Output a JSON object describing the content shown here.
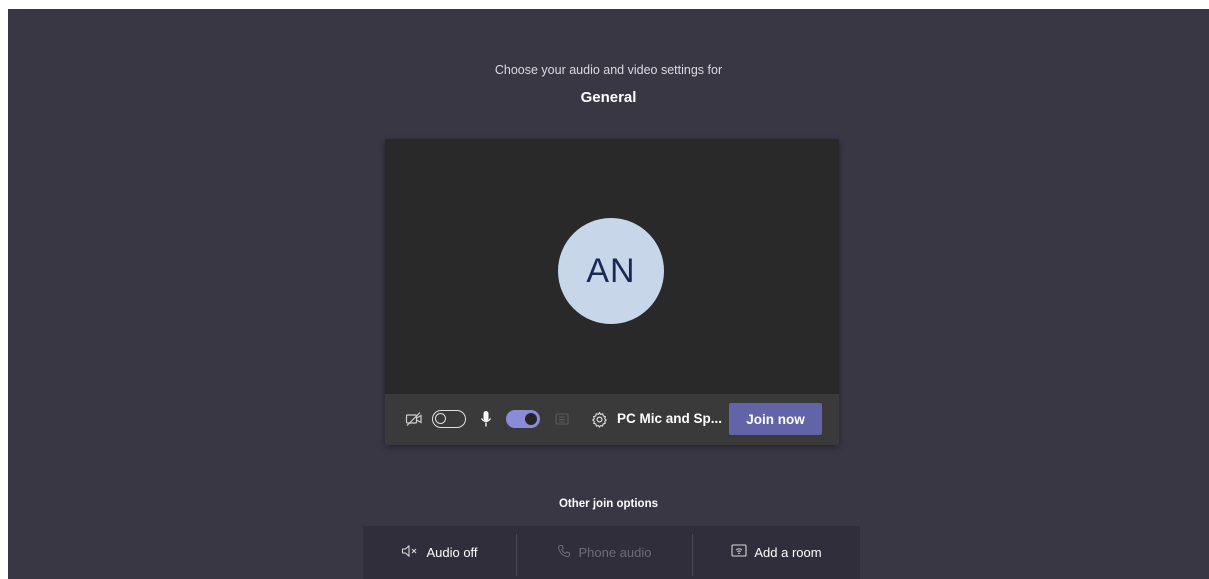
{
  "prejoin": {
    "subtitle": "Choose your audio and video settings for",
    "channel_name": "General"
  },
  "preview": {
    "avatar_initials": "AN"
  },
  "controls": {
    "camera_toggle_state": "off",
    "mic_toggle_state": "on",
    "device_label": "PC Mic and Sp...",
    "join_label": "Join now"
  },
  "other_options": {
    "heading": "Other join options",
    "items": [
      {
        "label": "Audio off",
        "icon": "speaker-mute-icon",
        "enabled": true
      },
      {
        "label": "Phone audio",
        "icon": "phone-icon",
        "enabled": false
      },
      {
        "label": "Add a room",
        "icon": "room-cast-icon",
        "enabled": true
      }
    ]
  },
  "colors": {
    "background": "#393744",
    "preview": "#292929",
    "accent": "#6264a7",
    "toggle_on": "#8b8cd8",
    "avatar_bg": "#c8d6ea",
    "avatar_text": "#1b2a55"
  }
}
